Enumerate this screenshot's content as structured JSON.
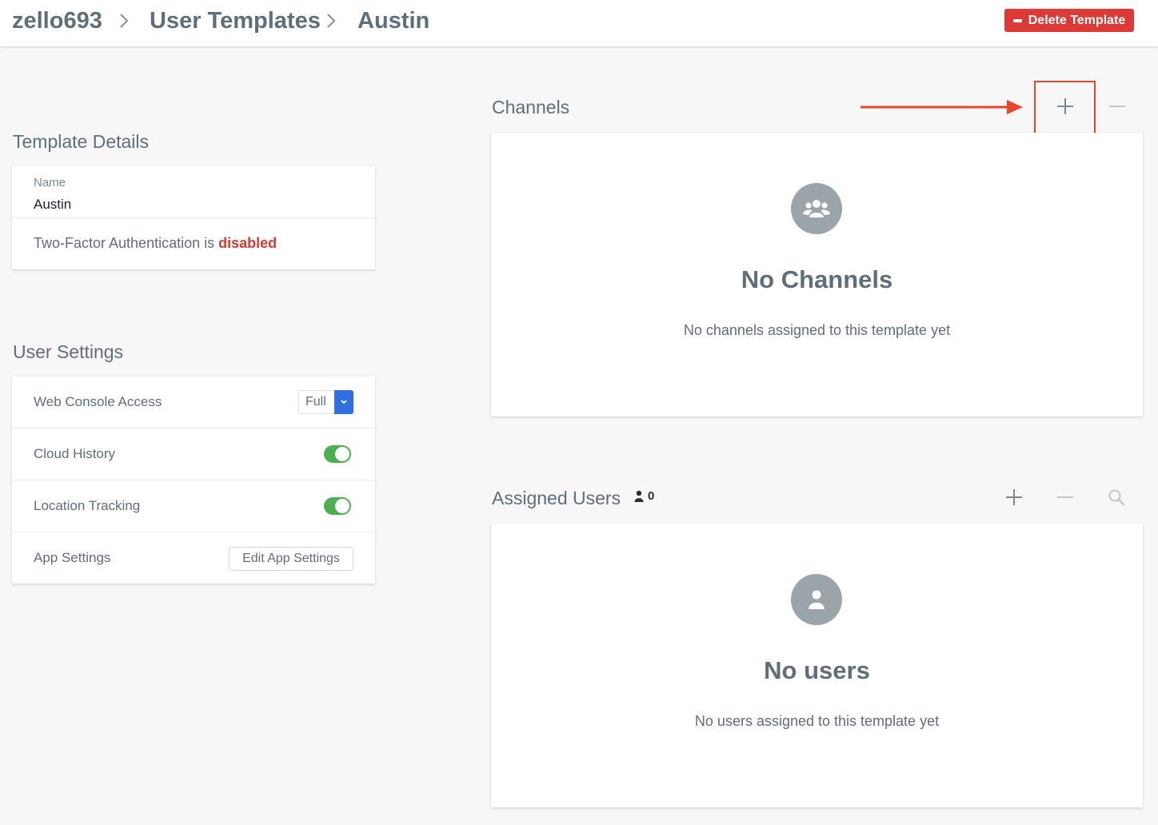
{
  "breadcrumb": {
    "items": [
      "zello693",
      "User Templates",
      "Austin"
    ]
  },
  "header": {
    "delete_label": "Delete Template"
  },
  "template_details": {
    "title": "Template Details",
    "name_label": "Name",
    "name_value": "Austin",
    "tfa_prefix": "Two-Factor Authentication is ",
    "tfa_status": "disabled"
  },
  "user_settings": {
    "title": "User Settings",
    "rows": [
      {
        "label": "Web Console Access",
        "control": "select",
        "value": "Full"
      },
      {
        "label": "Cloud History",
        "control": "toggle",
        "value": "on"
      },
      {
        "label": "Location Tracking",
        "control": "toggle",
        "value": "on"
      },
      {
        "label": "App Settings",
        "control": "button",
        "value": "Edit App Settings"
      }
    ]
  },
  "channels": {
    "title": "Channels",
    "empty_title": "No Channels",
    "empty_subtitle": "No channels assigned to this template yet"
  },
  "assigned_users": {
    "title": "Assigned Users",
    "count": "0",
    "empty_title": "No users",
    "empty_subtitle": "No users assigned to this template yet"
  },
  "colors": {
    "accent_blue": "#2f6fe0",
    "danger_red": "#dc3a37",
    "toggle_green": "#4caf50",
    "annotation_orange": "#e8462a"
  },
  "icons": [
    "chevron-right-icon",
    "minus-icon",
    "plus-icon",
    "search-icon",
    "group-icon",
    "user-icon",
    "person-icon",
    "chevron-down-icon",
    "arrow-right-icon"
  ]
}
